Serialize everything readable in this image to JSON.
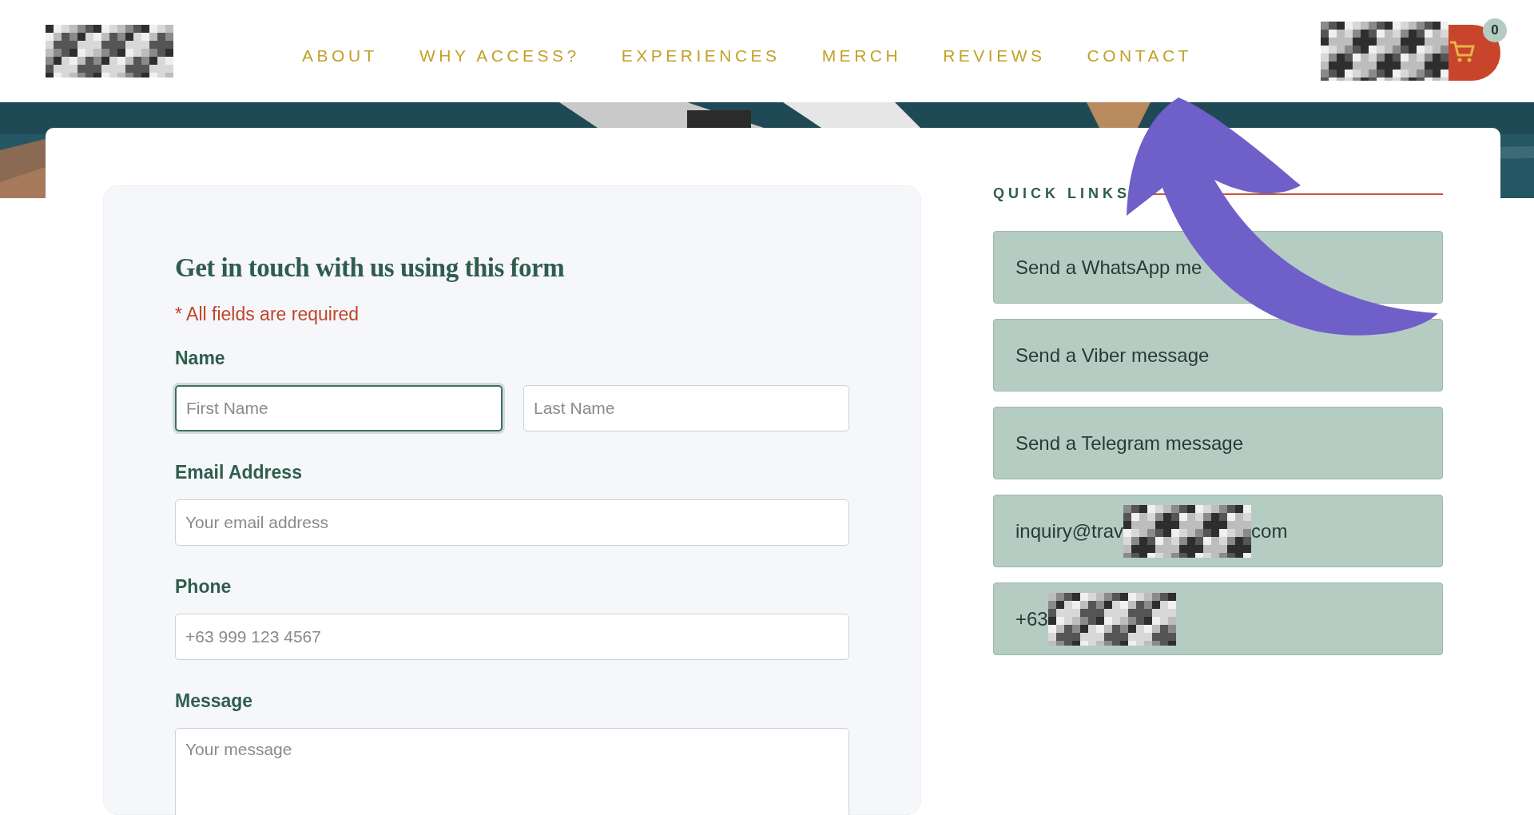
{
  "header": {
    "nav": [
      {
        "label": "ABOUT"
      },
      {
        "label": "WHY ACCESS?"
      },
      {
        "label": "EXPERIENCES"
      },
      {
        "label": "MERCH"
      },
      {
        "label": "REVIEWS"
      },
      {
        "label": "CONTACT"
      }
    ],
    "cart": {
      "count": "0"
    }
  },
  "form": {
    "title": "Get in touch with us using this form",
    "required_note": "* All fields are required",
    "groups": [
      {
        "label": "Name",
        "fields": [
          {
            "placeholder": "First Name",
            "focused": true
          },
          {
            "placeholder": "Last Name",
            "focused": false
          }
        ]
      },
      {
        "label": "Email Address",
        "fields": [
          {
            "placeholder": "Your email address",
            "focused": false
          }
        ]
      },
      {
        "label": "Phone",
        "fields": [
          {
            "placeholder": "+63 999 123 4567",
            "focused": false
          }
        ]
      },
      {
        "label": "Message",
        "kind": "textarea",
        "fields": [
          {
            "placeholder": "Your message",
            "focused": false
          }
        ]
      }
    ]
  },
  "quick_links": {
    "title": "QUICK LINKS",
    "links": [
      {
        "kind": "plain",
        "text": "Send a WhatsApp me"
      },
      {
        "kind": "plain",
        "text": "Send a Viber message"
      },
      {
        "kind": "plain",
        "text": "Send a Telegram message"
      },
      {
        "kind": "redacted",
        "before": "inquiry@trav",
        "after": "com"
      },
      {
        "kind": "redacted",
        "before": "+63"
      }
    ]
  }
}
